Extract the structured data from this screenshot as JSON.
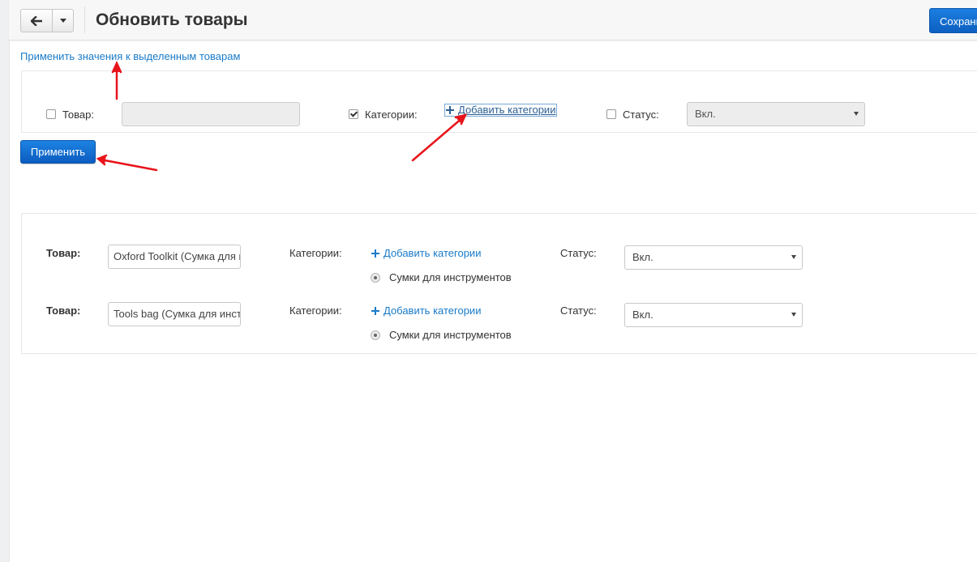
{
  "header": {
    "title": "Обновить товары",
    "save_label": "Сохранить"
  },
  "apply_selected_link": "Применить значения к выделенным товарам",
  "mass_edit": {
    "product_label": "Товар:",
    "product_checked": false,
    "product_value": "",
    "categories_label": "Категории:",
    "categories_checked": true,
    "add_categories_label": "Добавить категории",
    "status_label": "Статус:",
    "status_checked": false,
    "status_value": "Вкл."
  },
  "apply_button_label": "Применить",
  "products": [
    {
      "product_label": "Товар:",
      "name": "Oxford Toolkit (Сумка для инструментов)",
      "categories_label": "Категории:",
      "add_categories_label": "Добавить категории",
      "category": "Сумки для инструментов",
      "status_label": "Статус:",
      "status": "Вкл."
    },
    {
      "product_label": "Товар:",
      "name": "Tools bag (Сумка для инструментов)",
      "categories_label": "Категории:",
      "add_categories_label": "Добавить категории",
      "category": "Сумки для инструментов",
      "status_label": "Статус:",
      "status": "Вкл."
    }
  ],
  "colors": {
    "primary_button": "#0d5fc0",
    "link": "#1a7bc9",
    "annotation_arrow": "#e8141b"
  },
  "icons": [
    "arrow-left-icon",
    "caret-down-icon",
    "plus-icon",
    "checkbox-icon",
    "radio-icon"
  ]
}
